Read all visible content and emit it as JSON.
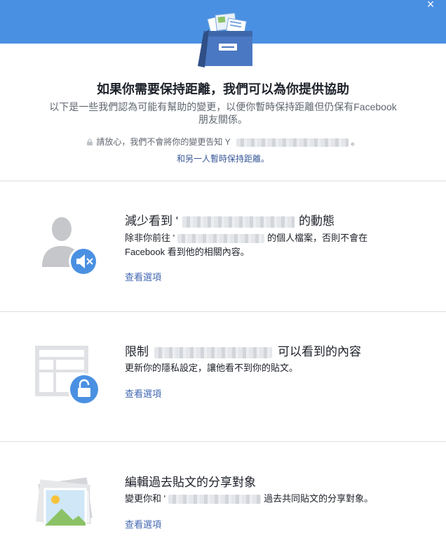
{
  "header": {
    "close_label": "×",
    "title": "如果你需要保持距離，我們可以為你提供協助",
    "subtitle": "以下是一些我們認為可能有幫助的變更，以便你暫時保持距離但仍保有Facebook 朋友關係。",
    "privacy_note": "請放心，我們不會將你的變更告知 Y",
    "privacy_note_end": "。",
    "alt_link": "和另一人暫時保持距離。"
  },
  "options": [
    {
      "title_start": "減少看到 '",
      "title_end": "的動態",
      "desc_start": "除非你前往 '",
      "desc_end": "的個人檔案，否則不會在",
      "desc_line2": "Facebook 看到他的相關內容。",
      "link": "查看選項",
      "icon": "mute-person-icon"
    },
    {
      "title_start": "限制",
      "title_end": "可以看到的內容",
      "desc": "更新你的隱私設定，讓他看不到你的貼文。",
      "link": "查看選項",
      "icon": "lock-profile-icon"
    },
    {
      "title": "編輯過去貼文的分享對象",
      "desc_start": "變更你和 '",
      "desc_end": "過去共同貼文的分享對象。",
      "link": "查看選項",
      "icon": "photos-icon"
    }
  ],
  "colors": {
    "brand_blue": "#4a90e2",
    "link": "#4267b2",
    "icon_grey": "#c5c7ca",
    "badge_blue": "#4a90e2"
  }
}
